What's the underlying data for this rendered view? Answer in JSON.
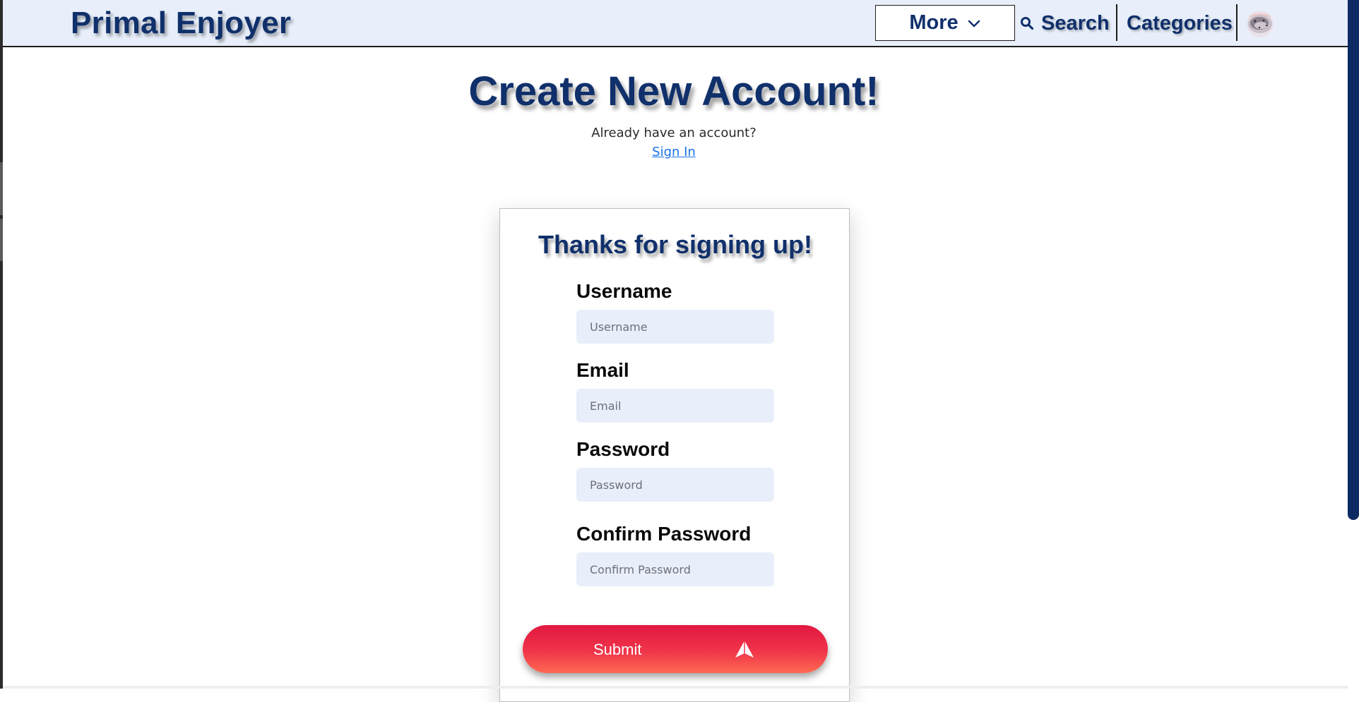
{
  "header": {
    "brand": "Primal Enjoyer",
    "more_label": "More",
    "search_label": "Search",
    "categories_label": "Categories"
  },
  "icons": {
    "chevron": "chevron-down-icon",
    "search": "search-icon",
    "avatar": "avatar",
    "submit": "arrow-up-icon"
  },
  "main": {
    "title": "Create New Account!",
    "already_text": "Already have an account?",
    "signin_label": "Sign In"
  },
  "form": {
    "title": "Thanks for signing up!",
    "fields": [
      {
        "label": "Username",
        "placeholder": "Username",
        "value": ""
      },
      {
        "label": "Email",
        "placeholder": "Email",
        "value": ""
      },
      {
        "label": "Password",
        "placeholder": "Password",
        "value": ""
      },
      {
        "label": "Confirm Password",
        "placeholder": "Confirm Password",
        "value": ""
      }
    ],
    "submit_label": "Submit"
  },
  "colors": {
    "brand": "#10306b",
    "nav_bg": "#e8effa",
    "input_bg": "#e8effa",
    "link": "#1a73e8",
    "submit_top": "#e21840",
    "submit_bottom": "#fd6a52",
    "scrollbar": "#0d2a63"
  }
}
